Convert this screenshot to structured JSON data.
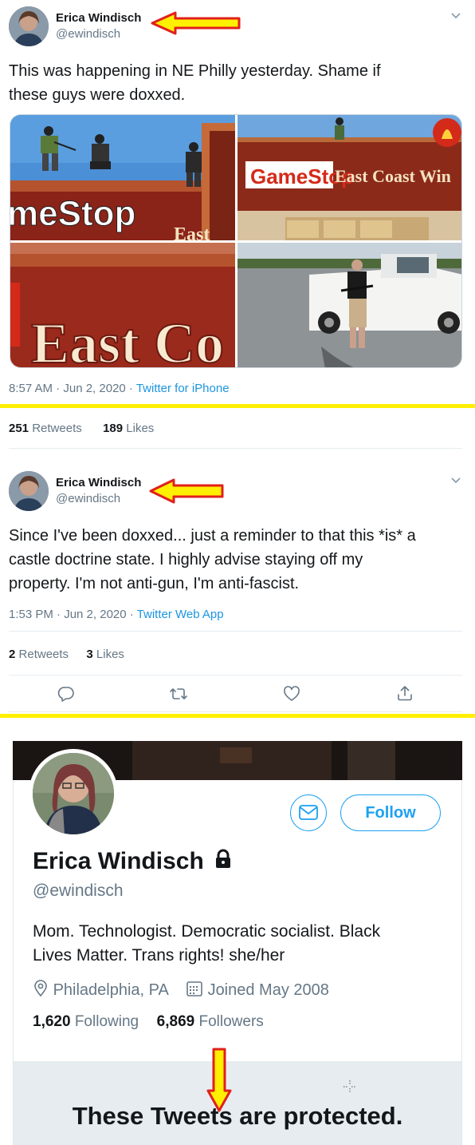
{
  "tweet1": {
    "name": "Erica Windisch",
    "handle": "@ewindisch",
    "text_line1": "This was happening in NE Philly yesterday. Shame if",
    "text_line2": "these guys were doxxed.",
    "photo_signs": {
      "gamestop_partial": "meStop",
      "east_partial": "East",
      "gamestop_full": "GameStop",
      "east_coast": "East Coast Win",
      "east_big": "East Co"
    },
    "time": "8:57 AM · Jun 2, 2020 · ",
    "source": "Twitter for iPhone",
    "retweets_count": "251",
    "retweets_label": "Retweets",
    "likes_count": "189",
    "likes_label": "Likes"
  },
  "tweet2": {
    "name": "Erica Windisch",
    "handle": "@ewindisch",
    "text_line1": "Since I've been doxxed... just a reminder to that this *is* a",
    "text_line2": "castle doctrine state. I highly advise staying off my",
    "text_line3": "property. I'm not anti-gun, I'm anti-fascist.",
    "time": "1:53 PM · Jun 2, 2020 · ",
    "source": "Twitter Web App",
    "retweets_count": "2",
    "retweets_label": "Retweets",
    "likes_count": "3",
    "likes_label": "Likes",
    "actions": [
      "reply-icon",
      "retweet-icon",
      "like-icon",
      "share-icon"
    ]
  },
  "profile": {
    "name": "Erica Windisch",
    "handle": "@ewindisch",
    "follow_label": "Follow",
    "bio_line1": "Mom. Technologist. Democratic socialist. Black",
    "bio_line2": "Lives Matter. Trans rights! she/her",
    "location": "Philadelphia, PA",
    "joined": "Joined May 2008",
    "following_count": "1,620",
    "following_label": "Following",
    "followers_count": "6,869",
    "followers_label": "Followers",
    "protected_text": "These Tweets are protected."
  },
  "colors": {
    "accent": "#1da1f2",
    "link": "#1b95e0",
    "annotation_arrow_fill": "#ffef00",
    "annotation_arrow_stroke": "#e0201c",
    "divider_yellow": "#ffef00"
  }
}
